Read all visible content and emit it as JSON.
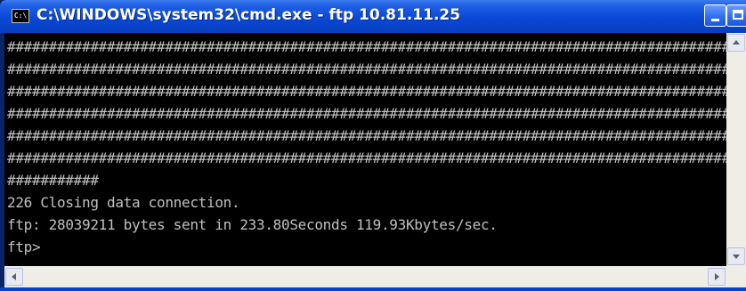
{
  "window": {
    "title": "C:\\WINDOWS\\system32\\cmd.exe - ftp 10.81.11.25",
    "icon": "cmd-icon",
    "icon_text": "C:\\"
  },
  "console": {
    "lines": [
      "##################################################################################################",
      "##################################################################################################",
      "##################################################################################################",
      "##################################################################################################",
      "##################################################################################################",
      "##################################################################################################",
      "###########",
      "226 Closing data connection.",
      "ftp: 28039211 bytes sent in 233.80Seconds 119.93Kbytes/sec.",
      "ftp>"
    ],
    "text_color": "#c0c0c0",
    "background": "#000000"
  },
  "colors": {
    "titlebar": "#0a48d6",
    "scrollbar": "#eeeee6"
  }
}
